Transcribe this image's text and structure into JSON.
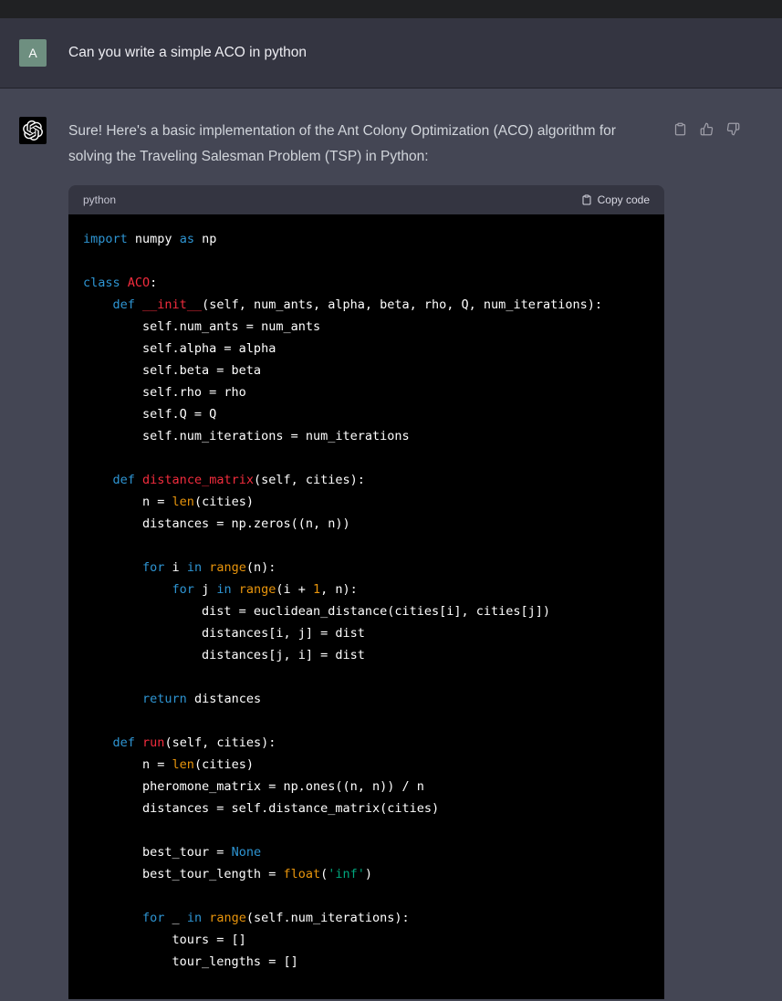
{
  "colors": {
    "page_background": "#444654",
    "user_row_background": "#343541",
    "top_bar_background": "#202123",
    "code_header_background": "#343541",
    "code_background": "#000000",
    "user_avatar_background": "#6e8f80",
    "assistant_avatar_background": "#000000",
    "syntax": {
      "plain": "#ffffff",
      "keyword": "#2e95d3",
      "title": "#f22c3d",
      "builtin": "#e9950c",
      "string": "#00a67d",
      "number": "#e9950c"
    }
  },
  "user_message": {
    "avatar_letter": "A",
    "text": "Can you write a simple ACO in python"
  },
  "assistant_message": {
    "intro": "Sure! Here's a basic implementation of the Ant Colony Optimization (ACO) algorithm for solving the Traveling Salesman Problem (TSP) in Python:",
    "action_icons": [
      "copy",
      "thumbs-up",
      "thumbs-down"
    ]
  },
  "code_block": {
    "language": "python",
    "copy_button_label": "Copy code",
    "token_types": {
      "pl": "plain",
      "kw": "keyword",
      "ti": "title",
      "bi": "builtin",
      "st": "string",
      "nu": "number"
    },
    "lines": [
      [
        [
          "kw",
          "import"
        ],
        [
          "pl",
          " numpy "
        ],
        [
          "kw",
          "as"
        ],
        [
          "pl",
          " np"
        ]
      ],
      [],
      [
        [
          "kw",
          "class"
        ],
        [
          "pl",
          " "
        ],
        [
          "ti",
          "ACO"
        ],
        [
          "pl",
          ":"
        ]
      ],
      [
        [
          "pl",
          "    "
        ],
        [
          "kw",
          "def"
        ],
        [
          "pl",
          " "
        ],
        [
          "ti",
          "__init__"
        ],
        [
          "pl",
          "(self, num_ants, alpha, beta, rho, Q, num_iterations):"
        ]
      ],
      [
        [
          "pl",
          "        self.num_ants = num_ants"
        ]
      ],
      [
        [
          "pl",
          "        self.alpha = alpha"
        ]
      ],
      [
        [
          "pl",
          "        self.beta = beta"
        ]
      ],
      [
        [
          "pl",
          "        self.rho = rho"
        ]
      ],
      [
        [
          "pl",
          "        self.Q = Q"
        ]
      ],
      [
        [
          "pl",
          "        self.num_iterations = num_iterations"
        ]
      ],
      [],
      [
        [
          "pl",
          "    "
        ],
        [
          "kw",
          "def"
        ],
        [
          "pl",
          " "
        ],
        [
          "ti",
          "distance_matrix"
        ],
        [
          "pl",
          "(self, cities):"
        ]
      ],
      [
        [
          "pl",
          "        n = "
        ],
        [
          "bi",
          "len"
        ],
        [
          "pl",
          "(cities)"
        ]
      ],
      [
        [
          "pl",
          "        distances = np.zeros((n, n))"
        ]
      ],
      [],
      [
        [
          "pl",
          "        "
        ],
        [
          "kw",
          "for"
        ],
        [
          "pl",
          " i "
        ],
        [
          "kw",
          "in"
        ],
        [
          "pl",
          " "
        ],
        [
          "bi",
          "range"
        ],
        [
          "pl",
          "(n):"
        ]
      ],
      [
        [
          "pl",
          "            "
        ],
        [
          "kw",
          "for"
        ],
        [
          "pl",
          " j "
        ],
        [
          "kw",
          "in"
        ],
        [
          "pl",
          " "
        ],
        [
          "bi",
          "range"
        ],
        [
          "pl",
          "(i + "
        ],
        [
          "nu",
          "1"
        ],
        [
          "pl",
          ", n):"
        ]
      ],
      [
        [
          "pl",
          "                dist = euclidean_distance(cities[i], cities[j])"
        ]
      ],
      [
        [
          "pl",
          "                distances[i, j] = dist"
        ]
      ],
      [
        [
          "pl",
          "                distances[j, i] = dist"
        ]
      ],
      [],
      [
        [
          "pl",
          "        "
        ],
        [
          "kw",
          "return"
        ],
        [
          "pl",
          " distances"
        ]
      ],
      [],
      [
        [
          "pl",
          "    "
        ],
        [
          "kw",
          "def"
        ],
        [
          "pl",
          " "
        ],
        [
          "ti",
          "run"
        ],
        [
          "pl",
          "(self, cities):"
        ]
      ],
      [
        [
          "pl",
          "        n = "
        ],
        [
          "bi",
          "len"
        ],
        [
          "pl",
          "(cities)"
        ]
      ],
      [
        [
          "pl",
          "        pheromone_matrix = np.ones((n, n)) / n"
        ]
      ],
      [
        [
          "pl",
          "        distances = self.distance_matrix(cities)"
        ]
      ],
      [],
      [
        [
          "pl",
          "        best_tour = "
        ],
        [
          "kw",
          "None"
        ]
      ],
      [
        [
          "pl",
          "        best_tour_length = "
        ],
        [
          "bi",
          "float"
        ],
        [
          "pl",
          "("
        ],
        [
          "st",
          "'inf'"
        ],
        [
          "pl",
          ")"
        ]
      ],
      [],
      [
        [
          "pl",
          "        "
        ],
        [
          "kw",
          "for"
        ],
        [
          "pl",
          " _ "
        ],
        [
          "kw",
          "in"
        ],
        [
          "pl",
          " "
        ],
        [
          "bi",
          "range"
        ],
        [
          "pl",
          "(self.num_iterations):"
        ]
      ],
      [
        [
          "pl",
          "            tours = []"
        ]
      ],
      [
        [
          "pl",
          "            tour_lengths = []"
        ]
      ]
    ]
  }
}
